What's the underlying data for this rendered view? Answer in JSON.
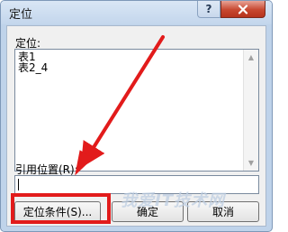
{
  "window": {
    "title": "定位",
    "help_icon_glyph": "?",
    "help_icon": "question-mark-icon",
    "close_icon": "close-icon"
  },
  "goto": {
    "label": "定位:",
    "items": [
      "表1",
      "表2_4"
    ]
  },
  "reference": {
    "label": "引用位置(R):",
    "value": ""
  },
  "buttons": {
    "special": "定位条件(S)...",
    "ok": "确定",
    "cancel": "取消"
  },
  "annotation": {
    "color": "#e21b1b"
  },
  "watermark": {
    "text": "我爱IT技术网"
  }
}
